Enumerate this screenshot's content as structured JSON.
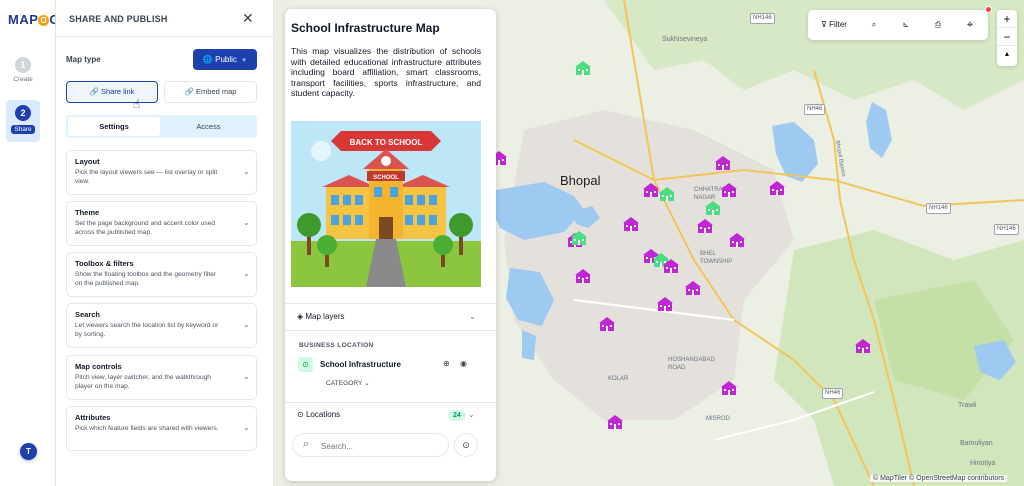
{
  "app": {
    "logo_text_before": "MAP",
    "logo_glyph": "O",
    "logo_text_after": "G"
  },
  "steps": [
    {
      "num": "1",
      "label": "Create"
    },
    {
      "num": "2",
      "label": "Share"
    }
  ],
  "user": {
    "initial": "T"
  },
  "panel": {
    "title": "SHARE AND PUBLISH",
    "map_type_label": "Map type",
    "visibility": "Public",
    "share_link_label": "Share link",
    "embed_map_label": "Embed map",
    "tabs": [
      {
        "label": "Settings",
        "active": true
      },
      {
        "label": "Access",
        "active": false
      }
    ],
    "sections": [
      {
        "title": "Layout",
        "description": "Pick the layout viewers see — list overlay or split view."
      },
      {
        "title": "Theme",
        "description": "Set the page background and accent color used across the published map."
      },
      {
        "title": "Toolbox & filters",
        "description": "Show the floating toolbox and the geometry filter on the published map."
      },
      {
        "title": "Search",
        "description": "Let viewers search the location list by keyword or by sorting."
      },
      {
        "title": "Map controls",
        "description": "Pitch view, layer switcher, and the walkthrough player on the map."
      },
      {
        "title": "Attributes",
        "description": "Pick which feature fields are shared with viewers."
      }
    ]
  },
  "card": {
    "title": "School Infrastructure Map",
    "description": "This map visualizes the distribution of schools with detailed educational infrastructure attributes including board affiliation, smart classrooms, transport facilities, sports infrastructure, and student capacity.",
    "image_banner": "BACK TO SCHOOL",
    "image_sign": "SCHOOL",
    "layers_label": "Map layers",
    "business_location_label": "BUSINESS LOCATION",
    "layer_name": "School Infrastructure",
    "category_label": "CATEGORY",
    "locations_label": "Locations",
    "locations_count": "24",
    "search_placeholder": "Search..."
  },
  "toolbar": {
    "filter_label": "Filter",
    "icons": [
      "search-icon",
      "measure-icon",
      "print-icon",
      "locate-icon"
    ]
  },
  "zoom": {
    "in": "+",
    "out": "−",
    "north": "▲"
  },
  "map": {
    "city": "Bhopal",
    "places": [
      "Sukhisevineya",
      "CHHATRAPATI NAGAR",
      "BHEL TOWNSHIP",
      "HOSHANGABAD ROAD",
      "KOLAR",
      "MISROD",
      "Trawli",
      "Bamuliyan",
      "Hinotiya"
    ],
    "roads": [
      "NH146",
      "NH146",
      "NH146",
      "NH46",
      "NH46"
    ],
    "road_label": "Bhopal Bypass",
    "attribution": "© MapTiler © OpenStreetMap contributors",
    "pin_colors": {
      "primary": "#c026d3",
      "secondary": "#4ade80"
    }
  },
  "colors": {
    "brand": "#1e40af",
    "accent_light": "#e0f2fe",
    "water": "#9ec9f0",
    "park": "#c5e0a6",
    "urban": "#e2dfda"
  }
}
